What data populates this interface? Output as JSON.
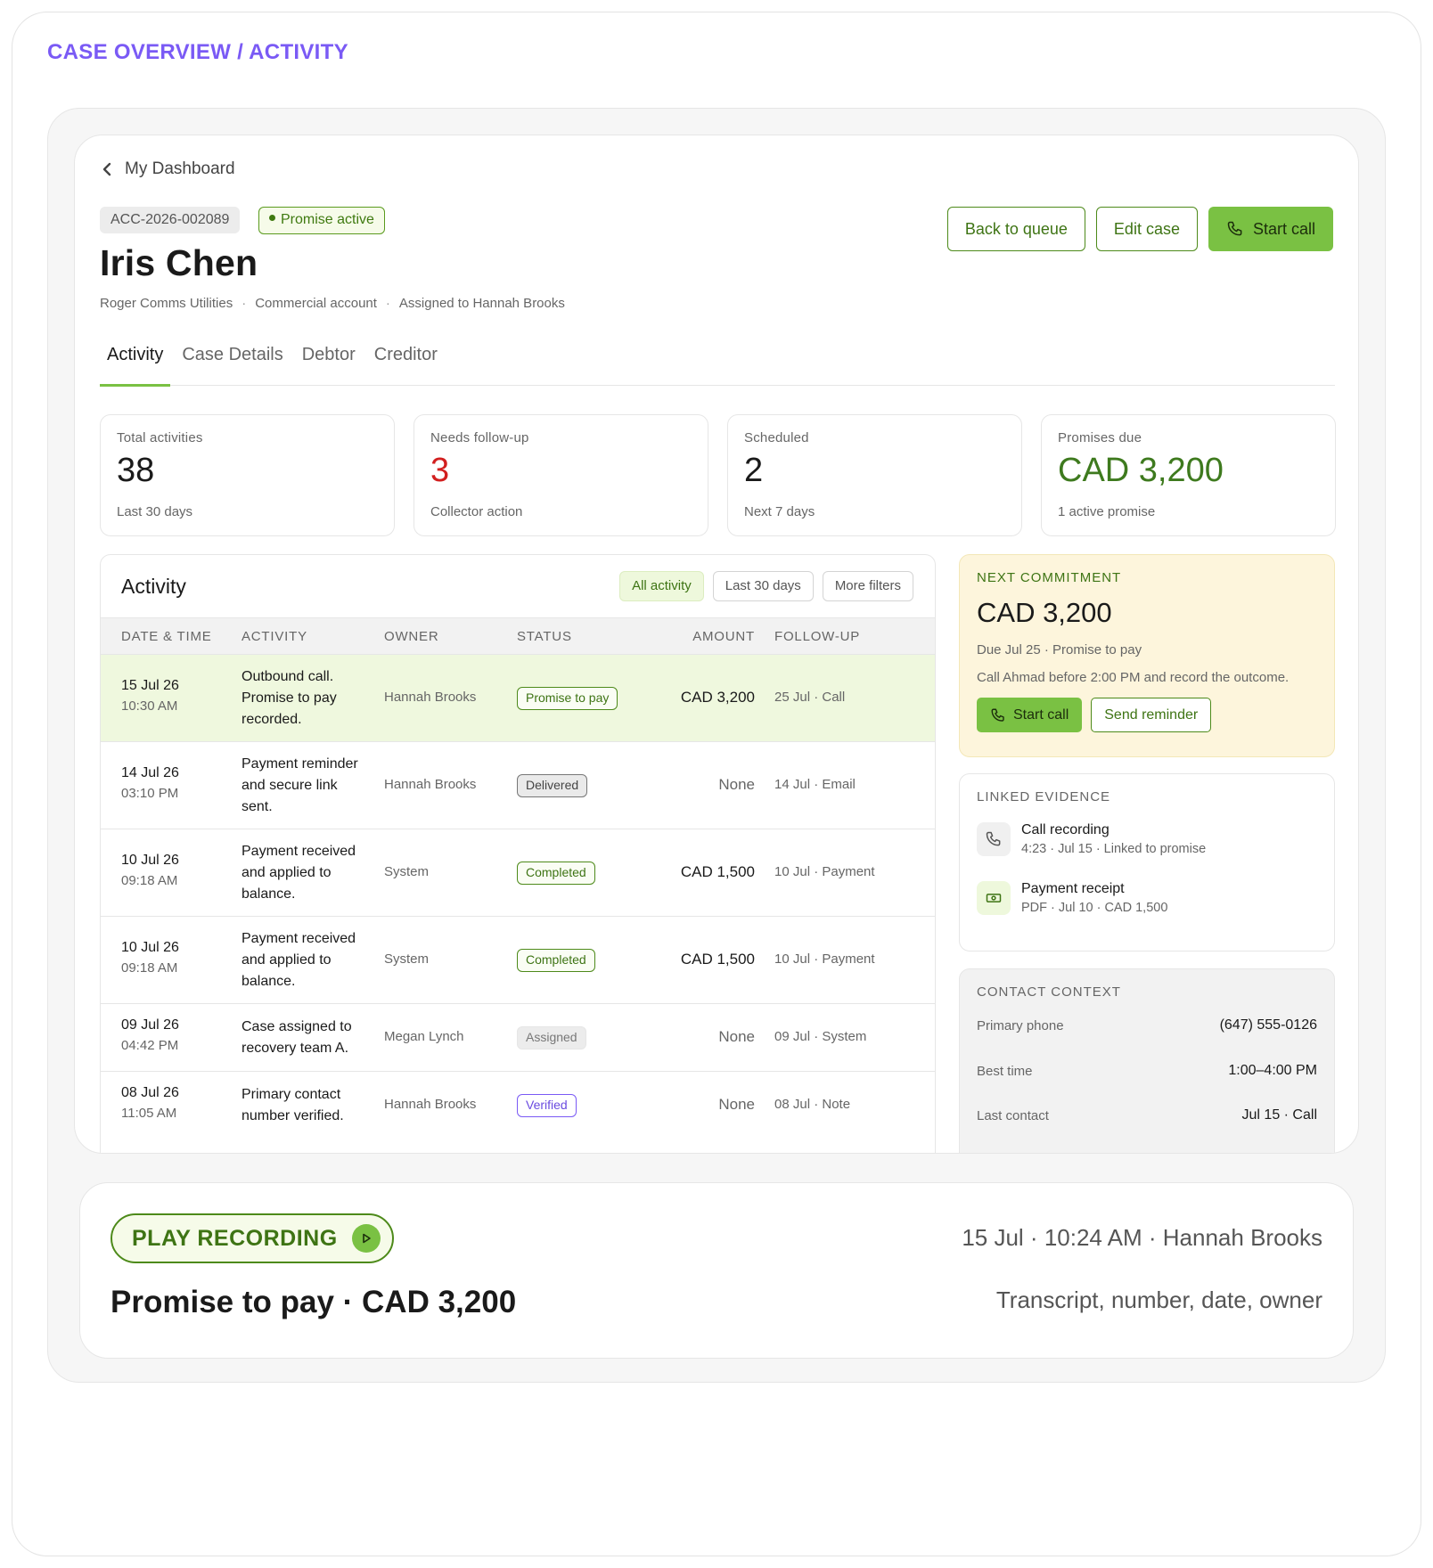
{
  "page": {
    "heading": "CASE OVERVIEW / ACTIVITY"
  },
  "case": {
    "back_label": "My Dashboard",
    "id": "ACC-2026-002089",
    "status_badge": "Promise active",
    "name": "Iris Chen",
    "meta": [
      "Roger Comms Utilities",
      "Commercial account",
      "Assigned to Hannah Brooks"
    ],
    "meta_separator": "·",
    "actions": {
      "back_to_queue": "Back to queue",
      "edit_case": "Edit case",
      "start_call": "Start call"
    }
  },
  "tabs": [
    {
      "label": "Activity",
      "active": true
    },
    {
      "label": "Case Details",
      "active": false
    },
    {
      "label": "Debtor",
      "active": false
    },
    {
      "label": "Creditor",
      "active": false
    }
  ],
  "stats": [
    {
      "label": "Total activities",
      "value": "38",
      "sub": "Last 30 days"
    },
    {
      "label": "Needs follow-up",
      "value": "3",
      "sub": "Collector action"
    },
    {
      "label": "Scheduled",
      "value": "2",
      "sub": "Next 7 days"
    },
    {
      "label": "Promises due",
      "value": "CAD 3,200",
      "sub": "1 active promise"
    }
  ],
  "activity": {
    "title": "Activity",
    "filters": [
      "All activity",
      "Last 30 days",
      "More filters"
    ],
    "columns": {
      "date": "DATE & TIME",
      "activity": "ACTIVITY",
      "owner": "OWNER",
      "status": "STATUS",
      "amount": "AMOUNT",
      "followup": "FOLLOW-UP"
    },
    "rows": [
      {
        "date": "15 Jul 26",
        "time": "10:30 AM",
        "activity": "Outbound call. Promise to pay recorded.",
        "owner": "Hannah Brooks",
        "status": "Promise to pay",
        "amount": "CAD 3,200",
        "followup": "25 Jul · Call"
      },
      {
        "date": "14 Jul 26",
        "time": "03:10 PM",
        "activity": "Payment reminder and secure link sent.",
        "owner": "Hannah Brooks",
        "status": "Delivered",
        "amount": "None",
        "followup": "14 Jul · Email"
      },
      {
        "date": "10 Jul 26",
        "time": "09:18 AM",
        "activity": "Payment received and applied to balance.",
        "owner": "System",
        "status": "Completed",
        "amount": "CAD 1,500",
        "followup": "10 Jul · Payment"
      },
      {
        "date": "10 Jul 26",
        "time": "09:18 AM",
        "activity": "Payment received and applied to balance.",
        "owner": "System",
        "status": "Completed",
        "amount": "CAD 1,500",
        "followup": "10 Jul · Payment"
      },
      {
        "date": "09 Jul 26",
        "time": "04:42 PM",
        "activity": "Case assigned to recovery team A.",
        "owner": "Megan Lynch",
        "status": "Assigned",
        "amount": "None",
        "followup": "09 Jul · System"
      },
      {
        "date": "08 Jul 26",
        "time": "11:05 AM",
        "activity": "Primary contact number verified.",
        "owner": "Hannah Brooks",
        "status": "Verified",
        "amount": "None",
        "followup": "08 Jul · Note"
      }
    ]
  },
  "commitment": {
    "label": "NEXT COMMITMENT",
    "amount": "CAD 3,200",
    "due": "Due Jul 25 · Promise to pay",
    "note": "Call Ahmad before 2:00 PM and record the outcome.",
    "start_call": "Start call",
    "send_reminder": "Send reminder"
  },
  "evidence": {
    "label": "LINKED EVIDENCE",
    "items": [
      {
        "title": "Call recording",
        "sub": "4:23 · Jul 15 · Linked to promise",
        "icon": "phone-icon"
      },
      {
        "title": "Payment receipt",
        "sub": "PDF · Jul 10 · CAD 1,500",
        "icon": "cash-icon"
      }
    ]
  },
  "contact": {
    "label": "CONTACT CONTEXT",
    "rows": [
      {
        "key": "Primary phone",
        "value": "(647) 555-0126"
      },
      {
        "key": "Best time",
        "value": "1:00–4:00 PM"
      },
      {
        "key": "Last contact",
        "value": "Jul 15 · Call"
      }
    ]
  },
  "recording": {
    "play_label": "PLAY RECORDING",
    "title": "Promise to pay · CAD 3,200",
    "meta": "15 Jul · 10:24 AM · Hannah Brooks",
    "hint": "Transcript, number, date, owner"
  },
  "colors": {
    "accent": "#7ac143",
    "accent_dark": "#3e7414",
    "heading": "#7a5af5",
    "alert": "#d21f1f",
    "commit_bg": "#fdf5dc"
  }
}
